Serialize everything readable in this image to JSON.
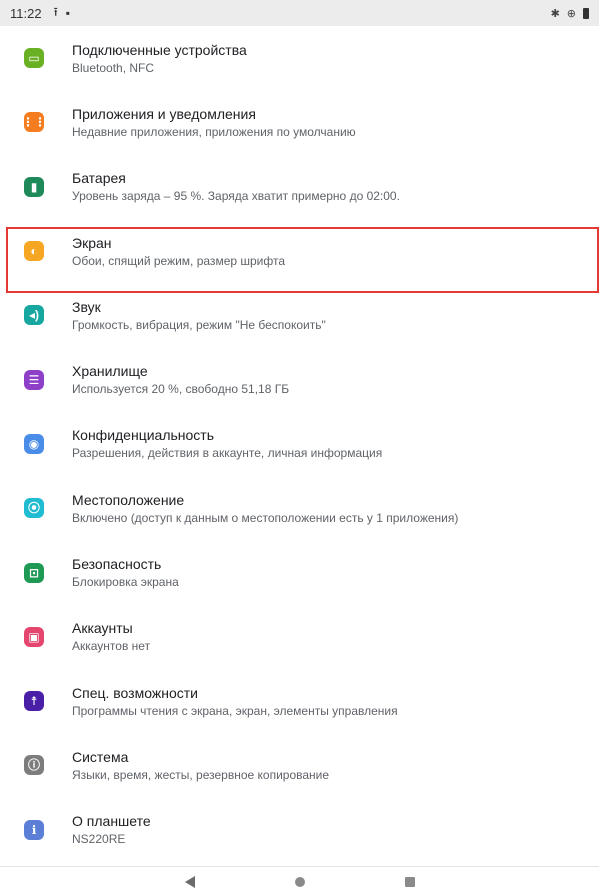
{
  "status_bar": {
    "time": "11:22",
    "left_icons": [
      "upload-icon",
      "sim-card-icon"
    ],
    "right_icons": [
      "bluetooth-icon",
      "data-saver-icon",
      "battery-icon"
    ]
  },
  "settings": {
    "items": [
      {
        "name": "connected-devices",
        "title": "Подключенные устройства",
        "subtitle": "Bluetooth, NFC",
        "icon": "devices-icon",
        "color": "#6ab023",
        "glyph": "▭"
      },
      {
        "name": "apps-notifications",
        "title": "Приложения и уведомления",
        "subtitle": "Недавние приложения, приложения по умолчанию",
        "icon": "apps-grid-icon",
        "color": "#f57c1f",
        "glyph": "⋮⋮"
      },
      {
        "name": "battery",
        "title": "Батарея",
        "subtitle": "Уровень заряда – 95 %. Заряда хватит примерно до 02:00.",
        "icon": "battery-icon",
        "color": "#1e8a5a",
        "glyph": "▮"
      },
      {
        "name": "display",
        "title": "Экран",
        "subtitle": "Обои, спящий режим, размер шрифта",
        "icon": "brightness-icon",
        "color": "#f6a623",
        "glyph": "◐"
      },
      {
        "name": "sound",
        "title": "Звук",
        "subtitle": "Громкость, вибрация, режим \"Не беспокоить\"",
        "icon": "volume-icon",
        "color": "#16a8a0",
        "glyph": "◂)"
      },
      {
        "name": "storage",
        "title": "Хранилище",
        "subtitle": "Используется 20 %, свободно 51,18 ГБ",
        "icon": "storage-icon",
        "color": "#8e3fc8",
        "glyph": "☰"
      },
      {
        "name": "privacy",
        "title": "Конфиденциальность",
        "subtitle": "Разрешения, действия в аккаунте, личная информация",
        "icon": "eye-lock-icon",
        "color": "#4a8de8",
        "glyph": "◉"
      },
      {
        "name": "location",
        "title": "Местоположение",
        "subtitle": "Включено (доступ к данным о местоположении есть у 1 приложения)",
        "icon": "location-pin-icon",
        "color": "#1fbcd2",
        "glyph": "⦿"
      },
      {
        "name": "security",
        "title": "Безопасность",
        "subtitle": "Блокировка экрана",
        "icon": "lock-icon",
        "color": "#1f9a55",
        "glyph": "⊡"
      },
      {
        "name": "accounts",
        "title": "Аккаунты",
        "subtitle": "Аккаунтов нет",
        "icon": "account-box-icon",
        "color": "#e4466e",
        "glyph": "▣"
      },
      {
        "name": "accessibility",
        "title": "Спец. возможности",
        "subtitle": "Программы чтения с экрана, экран, элементы управления",
        "icon": "accessibility-icon",
        "color": "#4a1fa8",
        "glyph": "☨"
      },
      {
        "name": "system",
        "title": "Система",
        "subtitle": "Языки, время, жесты, резервное копирование",
        "icon": "info-icon",
        "color": "#7d7d7d",
        "glyph": "ⓘ"
      },
      {
        "name": "about-tablet",
        "title": "О планшете",
        "subtitle": "NS220RE",
        "icon": "tablet-info-icon",
        "color": "#5b7fd6",
        "glyph": "ℹ"
      }
    ],
    "highlighted_item": "display",
    "highlight_color": "#e53935"
  },
  "nav_bar": {
    "buttons": [
      "back-icon",
      "home-icon",
      "recents-icon"
    ]
  }
}
